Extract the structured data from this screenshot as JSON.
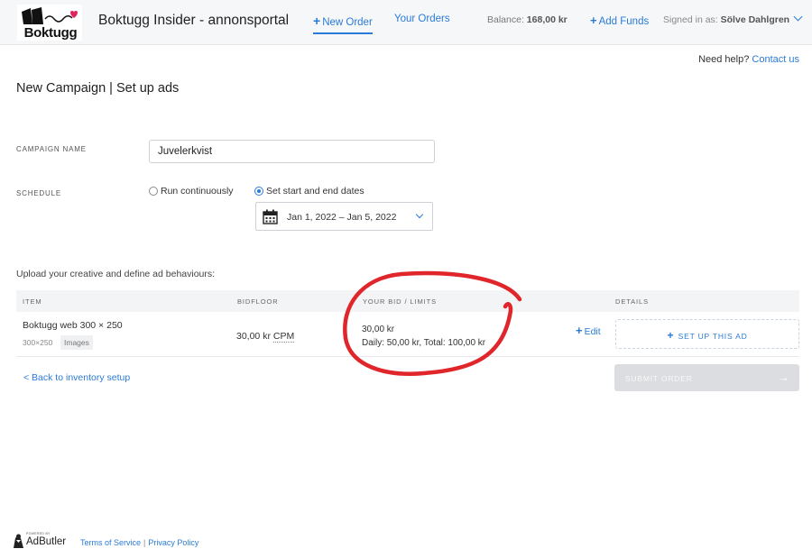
{
  "header": {
    "brand": "Boktugg",
    "site_title": "Boktugg Insider - annonsportal",
    "nav_new_order": "New Order",
    "nav_your_orders": "Your Orders",
    "balance_label": "Balance:",
    "balance_value": "168,00 kr",
    "add_funds": "Add Funds",
    "signed_in_label": "Signed in as:",
    "signed_in_user": "Sölve Dahlgren"
  },
  "help": {
    "text": "Need help?",
    "link": "Contact us"
  },
  "page": {
    "title": "New Campaign | Set up ads"
  },
  "form": {
    "campaign_name_label": "CAMPAIGN NAME",
    "campaign_name_value": "Juvelerkvist",
    "schedule_label": "SCHEDULE",
    "schedule_options": [
      "Run continuously",
      "Set start and end dates"
    ],
    "schedule_selected": "Set start and end dates",
    "date_range": "Jan 1, 2022 – Jan 5, 2022"
  },
  "upload_note": "Upload your creative and define ad behaviours:",
  "table": {
    "columns": [
      "ITEM",
      "BIDFLOOR",
      "YOUR BID / LIMITS",
      "DETAILS"
    ],
    "rows": [
      {
        "item_name": "Boktugg web 300 × 250",
        "item_size": "300×250",
        "item_tag": "Images",
        "bidfloor_value": "30,00 kr",
        "bidfloor_unit": "CPM",
        "bid": "30,00 kr",
        "limits": "Daily: 50,00 kr, Total: 100,00 kr",
        "edit_label": "Edit",
        "setup_label": "SET UP THIS AD"
      }
    ]
  },
  "actions": {
    "back": "< Back to inventory setup",
    "submit": "SUBMIT ORDER"
  },
  "footer": {
    "powered_by": "POWERED BY",
    "adbutler": "AdButler",
    "terms": "Terms of Service",
    "sep": "|",
    "privacy": "Privacy Policy"
  },
  "colors": {
    "accent": "#2a7bd8",
    "annotation": "#e0262b",
    "submit_disabled": "#dcdde0"
  }
}
